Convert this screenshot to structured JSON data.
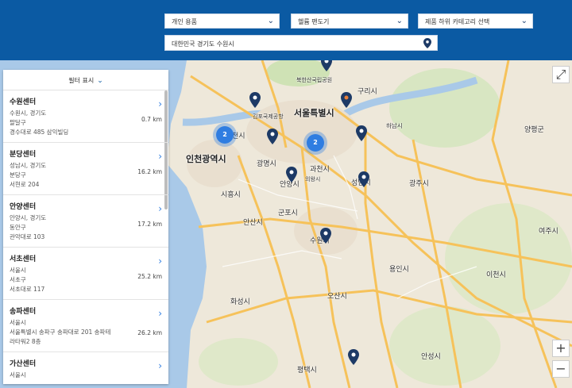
{
  "header": {
    "filter1": "개인 용품",
    "filter2": "헬륨 팬도기",
    "filter3": "제품 하위 카테고리 선택",
    "location": "대한민국 경기도 수원시"
  },
  "panel": {
    "filter_label": "필터 표시",
    "centers": [
      {
        "name": "수원센터",
        "city": "수원시, 경기도",
        "district": "팔달구",
        "address": "경수대로 485 삼익빌딩",
        "distance": "0.7 km"
      },
      {
        "name": "분당센터",
        "city": "성남시, 경기도",
        "district": "분당구",
        "address": "서현로 204",
        "distance": "16.2 km"
      },
      {
        "name": "안양센터",
        "city": "안양시, 경기도",
        "district": "동안구",
        "address": "관악대로 103",
        "distance": "17.2 km"
      },
      {
        "name": "서초센터",
        "city": "서울시",
        "district": "서초구",
        "address": "서초대로 117",
        "distance": "25.2 km"
      },
      {
        "name": "송파센터",
        "city": "서울시",
        "district": "서울특별시 송파구 송파대로 201 송파테",
        "address": "라타워2 8층",
        "distance": "26.2 km"
      },
      {
        "name": "가산센터",
        "city": "서울시",
        "district": "",
        "address": "",
        "distance": ""
      }
    ]
  },
  "map": {
    "labels": {
      "seoul": "서울특별시",
      "incheon": "인천광역시",
      "bucheon": "천시",
      "gwangmyeong": "광명시",
      "gwacheon": "과천시",
      "anyang": "안양시",
      "seongnam": "성남시",
      "uiwang": "의왕시",
      "gunpo": "군포시",
      "ansan": "안산시",
      "suwon": "수원시",
      "hwaseong": "화성시",
      "osan": "오산시",
      "yongin": "용인시",
      "icheon": "이천시",
      "gwangju": "광주시",
      "hanam": "하남시",
      "guri": "구리시",
      "yangpyeong": "양평군",
      "yeoju": "여주시",
      "anseong": "안성시",
      "pyeongtaek": "평택시",
      "siheung": "시흥시",
      "gimpo_airport": "김포국제공항",
      "bukhansan": "북한산국립공원"
    },
    "clusters": [
      "2",
      "2"
    ],
    "controls": {
      "zoom_in": "+",
      "zoom_out": "−",
      "fullscreen": "⤢"
    }
  },
  "colors": {
    "header": "#0b5aa3",
    "marker": "#1d3a66",
    "cluster": "#2f7de1",
    "road": "#f6c25a"
  }
}
